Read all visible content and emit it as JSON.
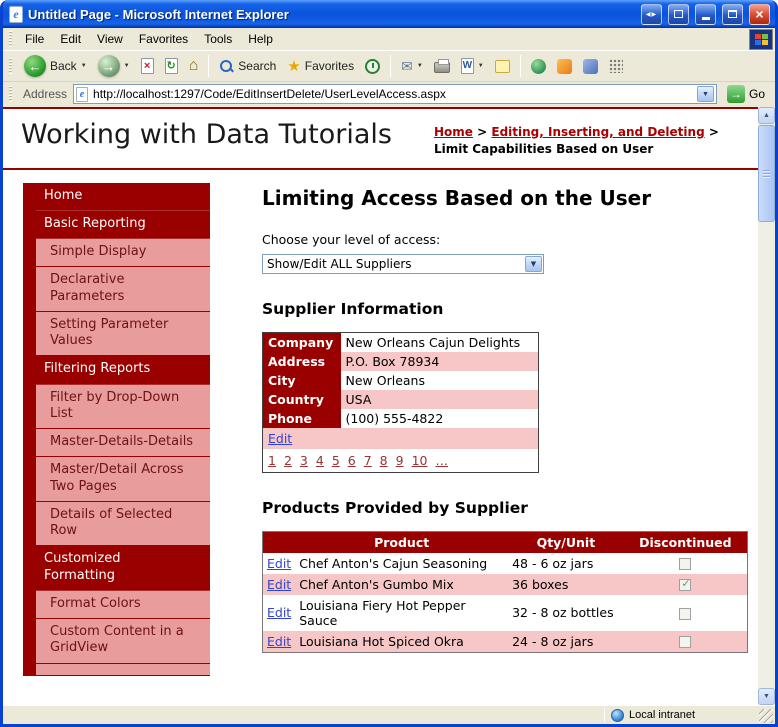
{
  "window": {
    "title": "Untitled Page - Microsoft Internet Explorer",
    "status_zone": "Local intranet"
  },
  "menu": {
    "items": [
      {
        "label": "File"
      },
      {
        "label": "Edit"
      },
      {
        "label": "View"
      },
      {
        "label": "Favorites"
      },
      {
        "label": "Tools"
      },
      {
        "label": "Help"
      }
    ]
  },
  "toolbar": {
    "back_label": "Back",
    "search_label": "Search",
    "favorites_label": "Favorites"
  },
  "address": {
    "label": "Address",
    "url": "http://localhost:1297/Code/EditInsertDelete/UserLevelAccess.aspx",
    "go_label": "Go"
  },
  "icons": {
    "ie": "e",
    "vm_arrows": "◀▶",
    "close_x": "×",
    "back": "←",
    "forward": "→",
    "stop": "×",
    "refresh": "↻",
    "home": "⌂",
    "favorites": "★",
    "mail": "✉",
    "word": "W",
    "go": "→",
    "dropdown": "▼",
    "up": "▲",
    "down": "▼"
  },
  "header": {
    "site_title": "Working with Data Tutorials",
    "breadcrumb": {
      "home": "Home",
      "sep": ">",
      "section": "Editing, Inserting, and Deleting",
      "current": "Limit Capabilities Based on User"
    }
  },
  "sidebar": {
    "items": [
      {
        "label": "Home",
        "type": "section"
      },
      {
        "label": "Basic Reporting",
        "type": "section"
      },
      {
        "label": "Simple Display",
        "type": "sub"
      },
      {
        "label": "Declarative Parameters",
        "type": "sub"
      },
      {
        "label": "Setting Parameter Values",
        "type": "sub"
      },
      {
        "label": "Filtering Reports",
        "type": "section"
      },
      {
        "label": "Filter by Drop-Down List",
        "type": "sub"
      },
      {
        "label": "Master-Details-Details",
        "type": "sub"
      },
      {
        "label": "Master/Detail Across Two Pages",
        "type": "sub"
      },
      {
        "label": "Details of Selected Row",
        "type": "sub"
      },
      {
        "label": "Customized Formatting",
        "type": "section"
      },
      {
        "label": "Format Colors",
        "type": "sub"
      },
      {
        "label": "Custom Content in a GridView",
        "type": "sub"
      }
    ]
  },
  "main": {
    "page_title": "Limiting Access Based on the User",
    "access_prompt": "Choose your level of access:",
    "access_select": {
      "value": "Show/Edit ALL Suppliers"
    },
    "supplier_heading": "Supplier Information",
    "supplier_details": {
      "rows": [
        {
          "label": "Company",
          "value": "New Orleans Cajun Delights"
        },
        {
          "label": "Address",
          "value": "P.O. Box 78934"
        },
        {
          "label": "City",
          "value": "New Orleans"
        },
        {
          "label": "Country",
          "value": "USA"
        },
        {
          "label": "Phone",
          "value": "(100) 555-4822"
        }
      ],
      "edit_label": "Edit",
      "pager": [
        "1",
        "2",
        "3",
        "4",
        "5",
        "6",
        "7",
        "8",
        "9",
        "10",
        "…"
      ]
    },
    "products_heading": "Products Provided by Supplier",
    "products_grid": {
      "headers": {
        "edit": "",
        "product": "Product",
        "qty": "Qty/Unit",
        "discontinued": "Discontinued"
      },
      "rows": [
        {
          "edit": "Edit",
          "product": "Chef Anton's Cajun Seasoning",
          "qty": "48 - 6 oz jars",
          "discontinued": false
        },
        {
          "edit": "Edit",
          "product": "Chef Anton's Gumbo Mix",
          "qty": "36 boxes",
          "discontinued": true
        },
        {
          "edit": "Edit",
          "product": "Louisiana Fiery Hot Pepper Sauce",
          "qty": "32 - 8 oz bottles",
          "discontinued": false
        },
        {
          "edit": "Edit",
          "product": "Louisiana Hot Spiced Okra",
          "qty": "24 - 8 oz jars",
          "discontinued": false
        }
      ]
    }
  },
  "colors": {
    "maroon": "#990000",
    "sidebar_pink": "#E89C9C",
    "row_pink": "#F7C6C6",
    "edit_link": "#3344CC",
    "pager_link": "#993333",
    "breadcrumb_link": "#AA0000",
    "titlebar_blue": "#0A53DC"
  }
}
